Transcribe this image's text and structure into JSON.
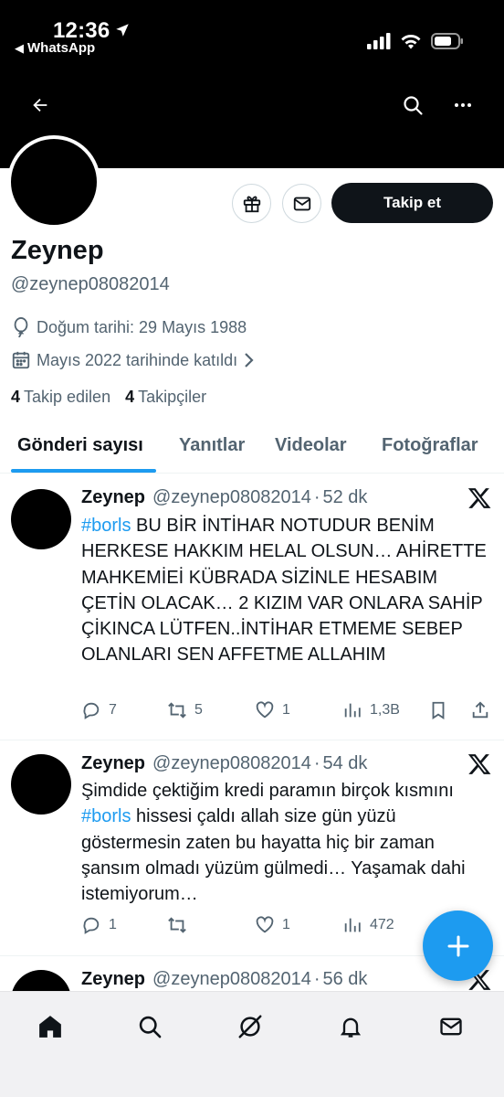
{
  "status_bar": {
    "time": "12:36",
    "back_app": "WhatsApp"
  },
  "profile": {
    "name": "Zeynep",
    "handle": "@zeynep08082014",
    "birth": "Doğum tarihi: 29 Mayıs 1988",
    "joined": "Mayıs 2022 tarihinde katıldı",
    "following_count": "4",
    "following_label": "Takip edilen",
    "followers_count": "4",
    "followers_label": "Takipçiler",
    "follow_button": "Takip et"
  },
  "tabs": [
    {
      "label": "Gönderi sayısı",
      "active": true
    },
    {
      "label": "Yanıtlar",
      "active": false
    },
    {
      "label": "Videolar",
      "active": false
    },
    {
      "label": "Fotoğraflar",
      "active": false
    }
  ],
  "tweets": [
    {
      "name": "Zeynep",
      "handle": "@zeynep08082014",
      "separator": "·",
      "time": "52 dk",
      "hashtag": "#borls",
      "text": "BU BİR İNTİHAR NOTUDUR BENİM HERKESE HAKKIM HELAL OLSUN… AHİRETTE MAHKEMİEİ KÜBRADA SİZİNLE HESABIM ÇETİN OLACAK… 2 KIZIM VAR ONLARA SAHİP ÇİKINCA LÜTFEN..İNTİHAR ETMEME SEBEP OLANLARI SEN AFFETME ALLAHIM",
      "replies": "7",
      "retweets": "5",
      "likes": "1",
      "views": "1,3B"
    },
    {
      "name": "Zeynep",
      "handle": "@zeynep08082014",
      "separator": "·",
      "time": "54 dk",
      "text_before": "Şimdide çektiğim kredi paramın birçok kısmını ",
      "hashtag": "#borls",
      "text_after": " hissesi çaldı allah size gün yüzü göstermesin zaten bu hayatta hiç bir zaman şansım olmadı yüzüm gülmedi… Yaşamak dahi istemiyorum…",
      "replies": "1",
      "retweets": "",
      "likes": "1",
      "views": "472"
    },
    {
      "name": "Zeynep",
      "handle": "@zeynep08082014",
      "separator": "·",
      "time": "56 dk"
    }
  ],
  "icons": {
    "back": "arrow-left-icon",
    "search": "search-icon",
    "more": "more-horizontal-icon",
    "gift": "gift-icon",
    "message": "envelope-icon",
    "balloon": "balloon-icon",
    "calendar": "calendar-icon",
    "x_logo": "x-logo-icon",
    "compose": "plus-icon"
  },
  "colors": {
    "accent": "#1d9bf0",
    "text": "#0f1419",
    "muted": "#536471",
    "banner": "#000000"
  }
}
